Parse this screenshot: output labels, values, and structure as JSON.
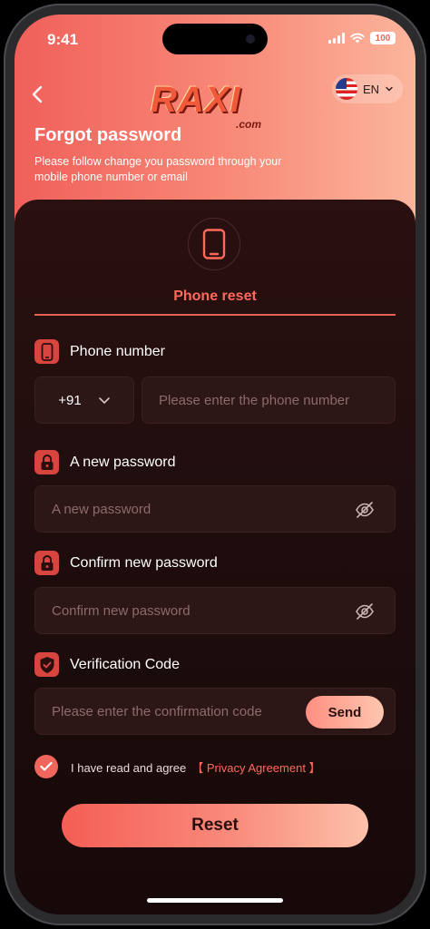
{
  "status_bar": {
    "time": "9:41",
    "battery": "100"
  },
  "header": {
    "logo_main": "RAXI",
    "logo_sub": ".com",
    "language": "EN",
    "title": "Forgot password",
    "description": "Please follow change you password through your mobile phone number or email"
  },
  "reset_mode": {
    "label": "Phone reset",
    "icon": "phone-icon"
  },
  "form": {
    "phone": {
      "label": "Phone number",
      "country_code": "+91",
      "placeholder": "Please enter the phone number"
    },
    "new_password": {
      "label": "A new password",
      "placeholder": "A new password"
    },
    "confirm_password": {
      "label": "Confirm new password",
      "placeholder": "Confirm new password"
    },
    "verification": {
      "label": "Verification Code",
      "placeholder": "Please enter the confirmation code",
      "send_label": "Send"
    },
    "agreement": {
      "text": "I have read and agree",
      "link": "【 Privacy Agreement 】",
      "checked": true
    },
    "submit_label": "Reset"
  },
  "colors": {
    "accent": "#ff6a5a",
    "hero_start": "#f0605a",
    "hero_end": "#fbb59c",
    "card_bg": "#1c0c0c",
    "input_bg": "#2d1616"
  }
}
